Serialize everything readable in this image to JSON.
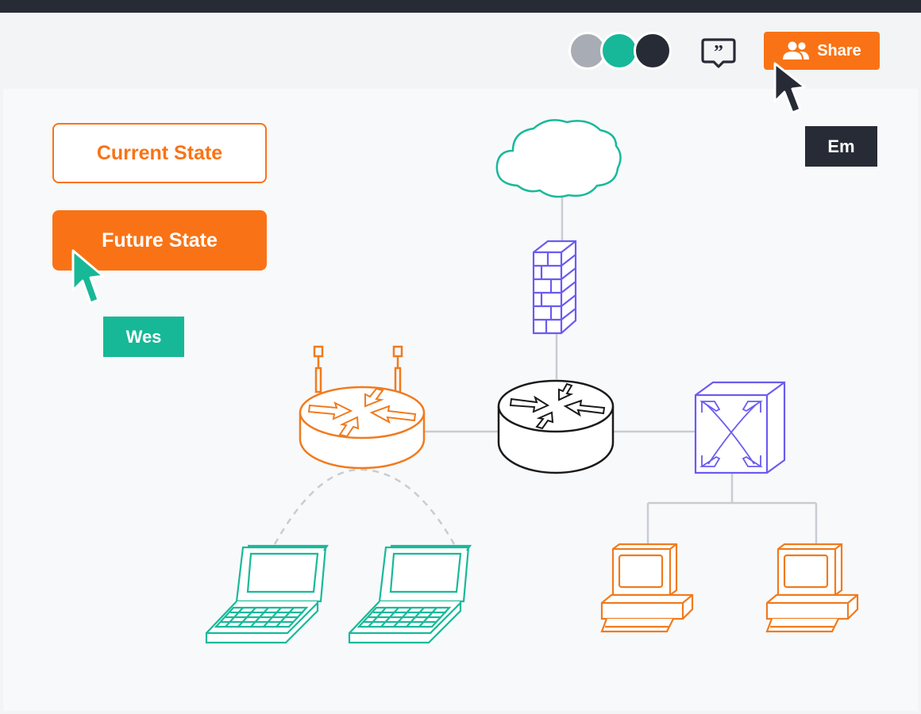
{
  "header": {
    "avatars": [
      {
        "name": "avatar-gray",
        "color": "#a8acb4"
      },
      {
        "name": "avatar-teal",
        "color": "#16b899"
      },
      {
        "name": "avatar-dark",
        "color": "#272b35"
      }
    ],
    "chat_icon": "quote-chat-icon",
    "share": {
      "label": "Share",
      "icon": "users-icon",
      "color": "#f97316"
    }
  },
  "sidebar": {
    "current_state_label": "Current State",
    "future_state_label": "Future State"
  },
  "collaborators": [
    {
      "name": "Em",
      "color": "#272b35"
    },
    {
      "name": "Wes",
      "color": "#17b897"
    }
  ],
  "diagram": {
    "nodes": [
      {
        "name": "cloud",
        "icon": "cloud-icon",
        "color": "#19b99a"
      },
      {
        "name": "firewall",
        "icon": "firewall-icon",
        "color": "#6a5cf0"
      },
      {
        "name": "core-router",
        "icon": "router-icon",
        "color": "#1a1a1a"
      },
      {
        "name": "wireless-router",
        "icon": "wireless-router-icon",
        "color": "#f07b1f"
      },
      {
        "name": "switch",
        "icon": "switch-icon",
        "color": "#6a5cf0"
      },
      {
        "name": "laptop-1",
        "icon": "laptop-icon",
        "color": "#19b99a"
      },
      {
        "name": "laptop-2",
        "icon": "laptop-icon",
        "color": "#19b99a"
      },
      {
        "name": "desktop-1",
        "icon": "desktop-icon",
        "color": "#f07b1f"
      },
      {
        "name": "desktop-2",
        "icon": "desktop-icon",
        "color": "#f07b1f"
      }
    ],
    "connector_color": "#c9ccd2"
  }
}
